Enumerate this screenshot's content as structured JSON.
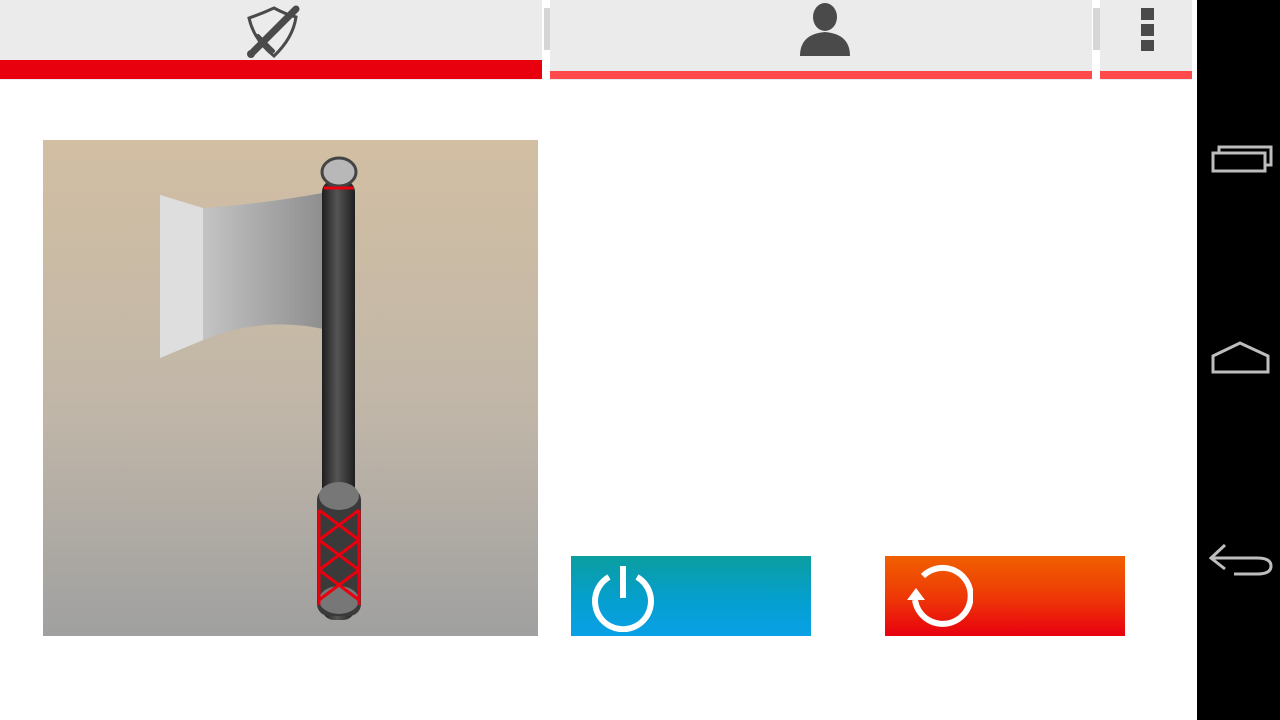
{
  "tabs": [
    {
      "id": "equipment",
      "icon": "shield-sword-icon",
      "selected": true
    },
    {
      "id": "profile",
      "icon": "user-icon",
      "selected": false
    },
    {
      "id": "more",
      "icon": "overflow-menu-icon",
      "selected": false
    }
  ],
  "item": {
    "image_icon": "battle-axe-image"
  },
  "actions": {
    "power": {
      "icon": "power-icon",
      "label": ""
    },
    "reset": {
      "icon": "refresh-icon",
      "label": ""
    }
  },
  "system_nav": [
    {
      "icon": "recent-apps-icon"
    },
    {
      "icon": "home-icon"
    },
    {
      "icon": "back-icon"
    }
  ],
  "colors": {
    "accent_red": "#e8000f",
    "tab_indicator": "#ff4b4b",
    "tab_bg": "#ebebeb",
    "power_gradient": [
      "#0a9ea0",
      "#0aa0e6"
    ],
    "reset_gradient": [
      "#f06000",
      "#e8000f"
    ],
    "nav_bg": "#000000"
  }
}
